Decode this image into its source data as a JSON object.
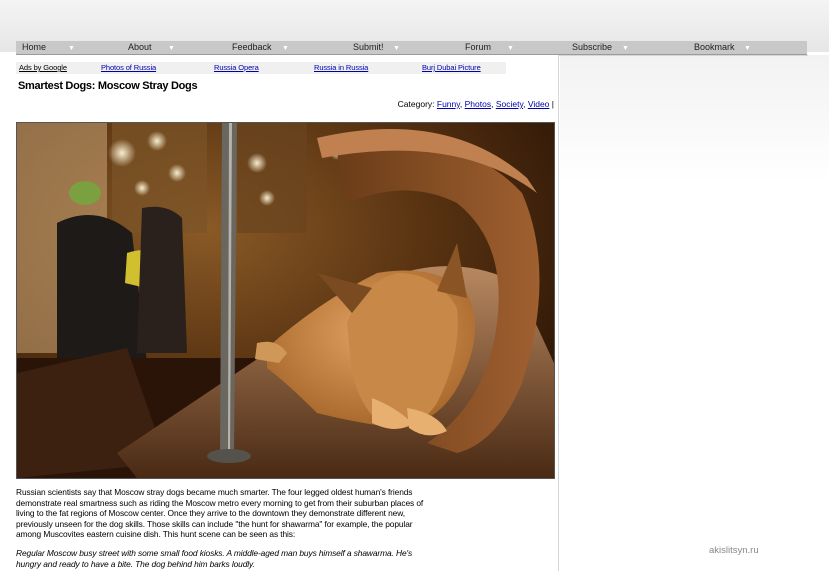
{
  "nav": {
    "items": [
      {
        "label": "Home"
      },
      {
        "label": "About"
      },
      {
        "label": "Feedback"
      },
      {
        "label": "Submit!"
      },
      {
        "label": "Forum"
      },
      {
        "label": "Subscribe"
      },
      {
        "label": "Bookmark"
      }
    ]
  },
  "ads": {
    "items": [
      "Ads by Google",
      "Photos of Russia",
      "Russia Opera",
      "Russia in Russia",
      "Burj Dubai Picture"
    ]
  },
  "article": {
    "title": "Smartest Dogs: Moscow Stray Dogs",
    "category_label": "Category:",
    "categories": [
      "Funny",
      "Photos",
      "Society",
      "Video"
    ],
    "category_end": "|",
    "paragraph1": "Russian scientists say that Moscow stray dogs became much smarter. The four legged oldest human's friends demonstrate real smartness such as riding the Moscow metro every morning to get from their suburban places of living to the fat regions of Moscow center. Once they arrive to the downtown they demonstrate different new, previously unseen for the dog skills. Those skills can include \"the hunt for shawarma\" for example, the popular among Muscovites eastern cuisine dish. This hunt scene can be seen as this:",
    "paragraph2": "Regular Moscow busy street with some small food kiosks. A middle-aged man buys himself a shawarma. He's hungry and ready to have a bite. The dog behind him barks loudly."
  },
  "photo": {
    "subject": "sleeping-dog-on-metro-seat"
  },
  "watermark": "akislitsyn.ru",
  "colors": {
    "link": "#0000aa",
    "navbar": "#c8c8c8"
  }
}
